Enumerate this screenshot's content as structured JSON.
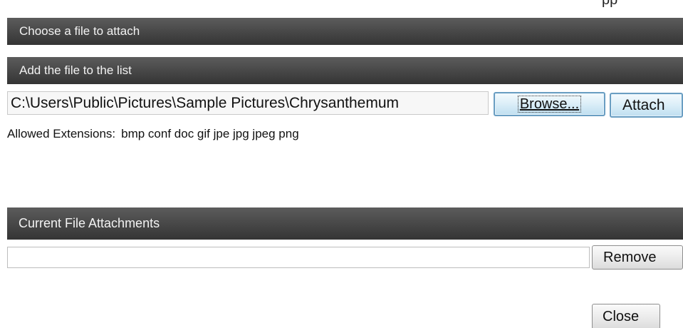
{
  "dialog": {
    "top_caption": "pp"
  },
  "sections": {
    "choose_title": "Choose a file to attach",
    "add_title": "Add the file to the list",
    "current_title": "Current File Attachments"
  },
  "file_input": {
    "value": "C:\\Users\\Public\\Pictures\\Sample Pictures\\Chrysanthemum"
  },
  "buttons": {
    "browse": "Browse...",
    "attach": "Attach",
    "remove": "Remove",
    "close": "Close"
  },
  "extensions": {
    "label": "Allowed Extensions:",
    "values": "bmp conf doc gif jpe jpg jpeg png"
  },
  "attachments": {
    "items": []
  }
}
